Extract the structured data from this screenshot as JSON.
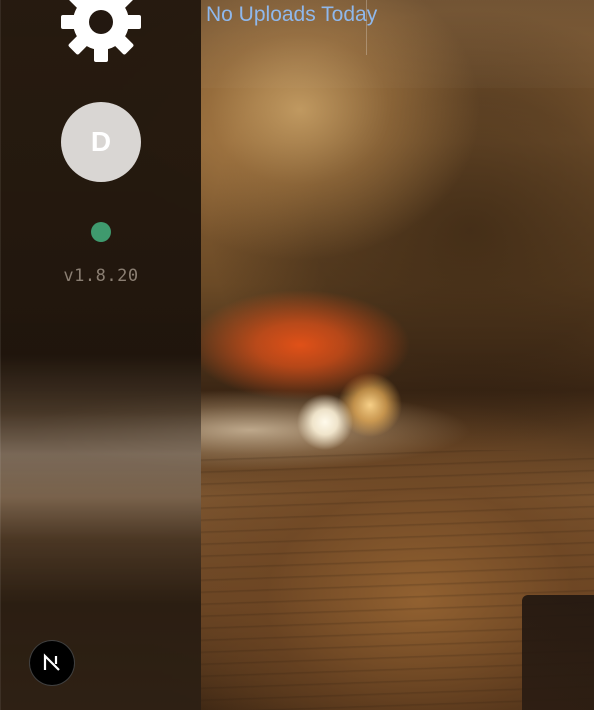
{
  "sidebar": {
    "settings_icon": "gear-icon",
    "avatar_initial": "D",
    "status_color": "#3f9a6e",
    "version": "v1.8.20",
    "framework_badge": "N"
  },
  "header": {
    "uploads_status": "No Uploads Today"
  },
  "colors": {
    "accent_link": "#8fb8ec",
    "status_online": "#3f9a6e",
    "avatar_bg": "#d9d6d3"
  }
}
